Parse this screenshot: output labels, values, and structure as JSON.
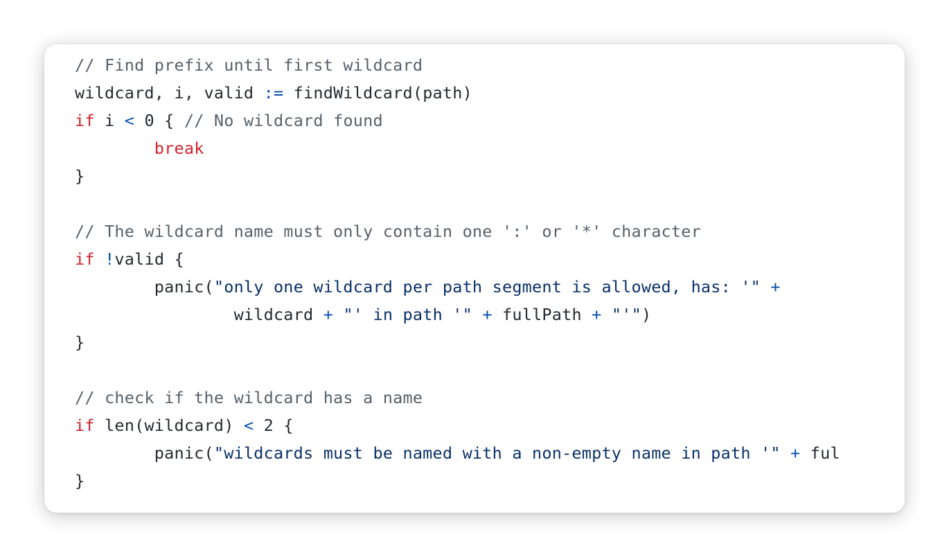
{
  "colors": {
    "comment": "#57606a",
    "keyword": "#cf222e",
    "operator": "#0550ae",
    "number": "#0550ae",
    "string": "#0a3069",
    "plain": "#24292f",
    "card_background": "#ffffff"
  },
  "code": {
    "language": "go",
    "lines": [
      [
        {
          "k": "comment",
          "t": "// Find prefix until first wildcard"
        }
      ],
      [
        {
          "k": "plain",
          "t": "wildcard, i, valid "
        },
        {
          "k": "operator",
          "t": ":="
        },
        {
          "k": "plain",
          "t": " findWildcard(path)"
        }
      ],
      [
        {
          "k": "keyword",
          "t": "if"
        },
        {
          "k": "plain",
          "t": " i "
        },
        {
          "k": "operator",
          "t": "<"
        },
        {
          "k": "plain",
          "t": " "
        },
        {
          "k": "number",
          "t": "0"
        },
        {
          "k": "plain",
          "t": " { "
        },
        {
          "k": "comment",
          "t": "// No wildcard found"
        }
      ],
      [
        {
          "k": "plain",
          "t": "        "
        },
        {
          "k": "keyword",
          "t": "break"
        }
      ],
      [
        {
          "k": "plain",
          "t": "}"
        }
      ],
      [],
      [
        {
          "k": "comment",
          "t": "// The wildcard name must only contain one ':' or '*' character"
        }
      ],
      [
        {
          "k": "keyword",
          "t": "if"
        },
        {
          "k": "plain",
          "t": " "
        },
        {
          "k": "operator",
          "t": "!"
        },
        {
          "k": "plain",
          "t": "valid {"
        }
      ],
      [
        {
          "k": "plain",
          "t": "        panic("
        },
        {
          "k": "string",
          "t": "\"only one wildcard per path segment is allowed, has: '\""
        },
        {
          "k": "plain",
          "t": " "
        },
        {
          "k": "operator",
          "t": "+"
        }
      ],
      [
        {
          "k": "plain",
          "t": "                wildcard "
        },
        {
          "k": "operator",
          "t": "+"
        },
        {
          "k": "plain",
          "t": " "
        },
        {
          "k": "string",
          "t": "\"' in path '\""
        },
        {
          "k": "plain",
          "t": " "
        },
        {
          "k": "operator",
          "t": "+"
        },
        {
          "k": "plain",
          "t": " fullPath "
        },
        {
          "k": "operator",
          "t": "+"
        },
        {
          "k": "plain",
          "t": " "
        },
        {
          "k": "string",
          "t": "\"'\""
        },
        {
          "k": "plain",
          "t": ")"
        }
      ],
      [
        {
          "k": "plain",
          "t": "}"
        }
      ],
      [],
      [
        {
          "k": "comment",
          "t": "// check if the wildcard has a name"
        }
      ],
      [
        {
          "k": "keyword",
          "t": "if"
        },
        {
          "k": "plain",
          "t": " len(wildcard) "
        },
        {
          "k": "operator",
          "t": "<"
        },
        {
          "k": "plain",
          "t": " "
        },
        {
          "k": "number",
          "t": "2"
        },
        {
          "k": "plain",
          "t": " {"
        }
      ],
      [
        {
          "k": "plain",
          "t": "        panic("
        },
        {
          "k": "string",
          "t": "\"wildcards must be named with a non-empty name in path '\""
        },
        {
          "k": "plain",
          "t": " "
        },
        {
          "k": "operator",
          "t": "+"
        },
        {
          "k": "plain",
          "t": " ful"
        }
      ],
      [
        {
          "k": "plain",
          "t": "}"
        }
      ]
    ]
  }
}
